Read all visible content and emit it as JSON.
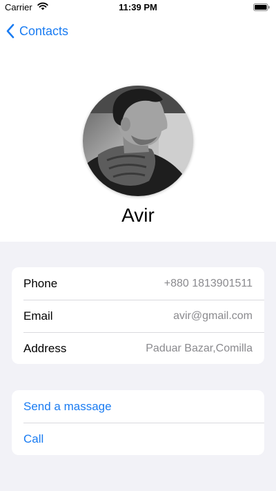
{
  "status_bar": {
    "carrier": "Carrier",
    "time": "11:39 PM"
  },
  "nav": {
    "back_label": "Contacts"
  },
  "contact": {
    "name": "Avir",
    "fields": [
      {
        "label": "Phone",
        "value": "+880 1813901511"
      },
      {
        "label": "Email",
        "value": "avir@gmail.com"
      },
      {
        "label": "Address",
        "value": "Paduar Bazar,Comilla"
      }
    ]
  },
  "actions": [
    {
      "label": "Send a massage"
    },
    {
      "label": "Call"
    }
  ],
  "colors": {
    "accent": "#1a7cf2",
    "background": "#f2f2f7",
    "secondary_text": "#8a8a8e"
  }
}
